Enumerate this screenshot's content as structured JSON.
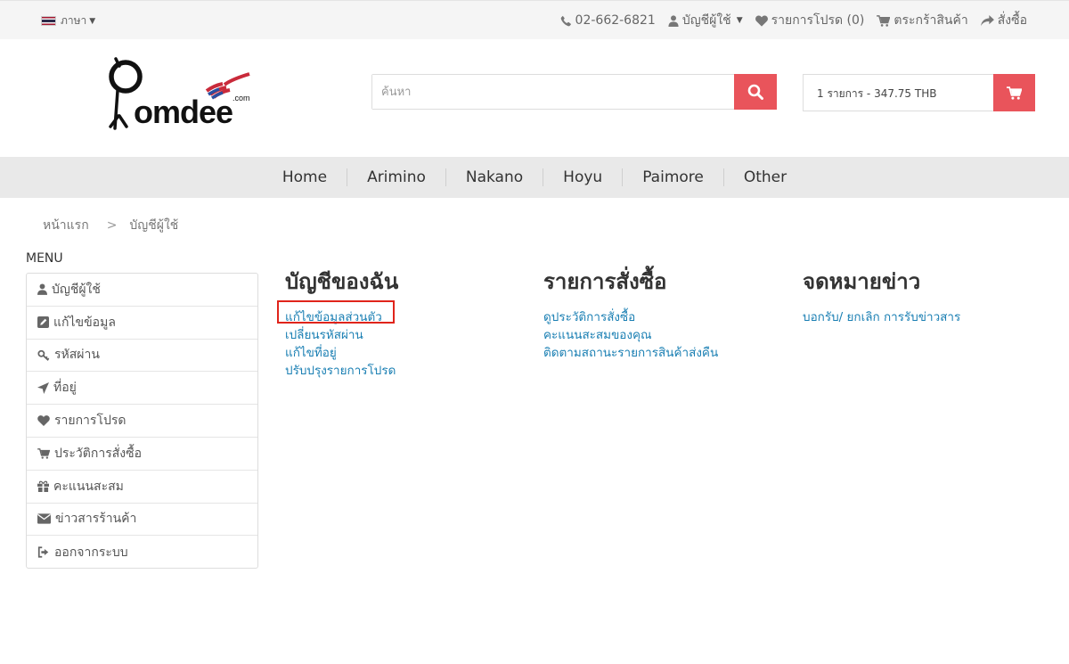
{
  "topbar": {
    "language_label": "ภาษา",
    "phone": "02-662-6821",
    "account": "บัญชีผู้ใช้",
    "wishlist": "รายการโปรด (0)",
    "cart": "ตระกร้าสินค้า",
    "checkout": "สั่งซื้อ"
  },
  "header": {
    "logo_text": "Pomdee",
    "logo_suffix": ".com",
    "search_placeholder": "ค้นหา",
    "cart_summary": "1 รายการ - 347.75 THB"
  },
  "nav": {
    "items": [
      "Home",
      "Arimino",
      "Nakano",
      "Hoyu",
      "Paimore",
      "Other"
    ]
  },
  "breadcrumb": {
    "home": "หน้าแรก",
    "current": "บัญชีผู้ใช้"
  },
  "sidebar": {
    "title": "MENU",
    "items": [
      {
        "label": "บัญชีผู้ใช้",
        "icon": "user-icon"
      },
      {
        "label": "แก้ไขข้อมูล",
        "icon": "edit-icon"
      },
      {
        "label": "รหัสผ่าน",
        "icon": "key-icon"
      },
      {
        "label": "ที่อยู่",
        "icon": "location-arrow-icon"
      },
      {
        "label": "รายการโปรด",
        "icon": "heart-icon"
      },
      {
        "label": "ประวัติการสั่งซื้อ",
        "icon": "cart-icon"
      },
      {
        "label": "คะแนนสะสม",
        "icon": "gift-icon"
      },
      {
        "label": "ข่าวสารร้านค้า",
        "icon": "envelope-icon"
      },
      {
        "label": "ออกจากระบบ",
        "icon": "sign-out-icon"
      }
    ]
  },
  "content": {
    "my_account": {
      "title": "บัญชีของฉัน",
      "links": [
        "แก้ไขข้อมูลส่วนตัว",
        "เปลี่ยนรหัสผ่าน",
        "แก้ไขที่อยู่",
        "ปรับปรุงรายการโปรด"
      ]
    },
    "orders": {
      "title": "รายการสั่งซื้อ",
      "links": [
        "ดูประวัติการสั่งซื้อ",
        "คะแนนสะสมของคุณ",
        "ติดตามสถานะรายการสินค้าส่งคืน"
      ]
    },
    "newsletter": {
      "title": "จดหมายข่าว",
      "links": [
        "บอกรับ/ ยกเลิก การรับข่าวสาร"
      ]
    }
  },
  "colors": {
    "accent": "#e9545b",
    "link": "#1a7fb3",
    "highlight": "#e0241b"
  }
}
